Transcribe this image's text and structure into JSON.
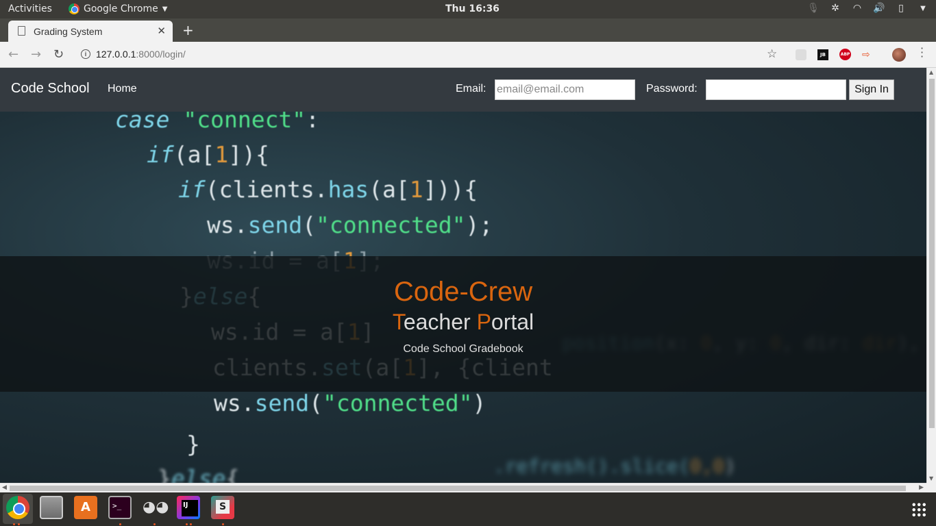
{
  "system": {
    "activities": "Activities",
    "app_name": "Google Chrome",
    "clock": "Thu 16:36"
  },
  "browser": {
    "tab_title": "Grading System",
    "url_host": "127.0.0.1",
    "url_rest": ":8000/login/"
  },
  "navbar": {
    "brand": "Code School",
    "home": "Home",
    "email_label": "Email:",
    "email_placeholder": "email@email.com",
    "password_label": "Password:",
    "signin": "Sign In"
  },
  "hero": {
    "title": "Code-Crew",
    "subtitle_t": "T",
    "subtitle_eacher": "eacher ",
    "subtitle_p": "P",
    "subtitle_ortal": "ortal",
    "tagline": "Code School Gradebook",
    "code_lines": [
      "case \"connect\":",
      "if(a[1]){",
      "if(clients.has(a[1])){",
      "ws.send(\"connected\");",
      "ws.id = a[1];",
      "}else{",
      "ws.id = a[1]",
      "clients.set(a[1], {client",
      "ws.send(\"connected\")",
      "}",
      "}else{"
    ]
  },
  "colors": {
    "accent": "#d9650f",
    "navbar_bg": "#343a40",
    "band_bg": "#0f1416"
  },
  "icons": {
    "tray": [
      "microphone-icon",
      "network-icon",
      "wifi-icon",
      "volume-icon",
      "battery-icon"
    ],
    "dock": [
      "chrome-icon",
      "files-icon",
      "software-store-icon",
      "terminal-icon",
      "gimp-icon",
      "intellij-icon",
      "sublime-icon",
      "apps-grid-icon"
    ]
  }
}
